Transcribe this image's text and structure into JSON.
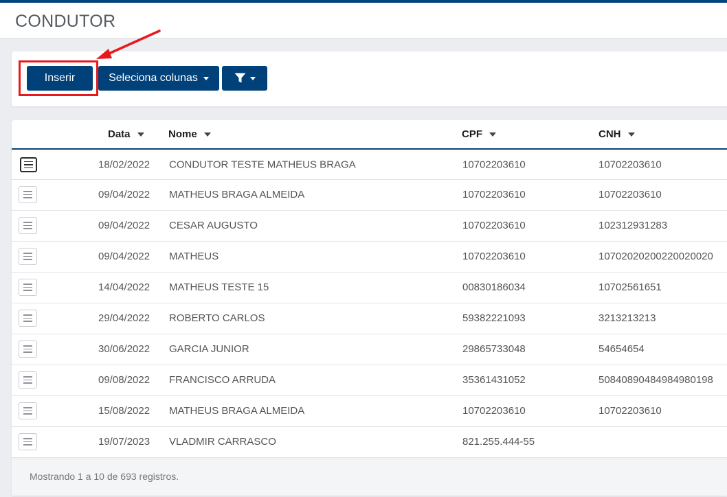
{
  "page": {
    "title": "CONDUTOR"
  },
  "toolbar": {
    "insert_label": "Inserir",
    "columns_label": "Seleciona colunas",
    "filter_icon": "filter-icon"
  },
  "colors": {
    "primary": "#00417a",
    "highlight": "#e8191d"
  },
  "table": {
    "columns": [
      "Data",
      "Nome",
      "CPF",
      "CNH"
    ],
    "rows": [
      {
        "data": "18/02/2022",
        "nome": "CONDUTOR TESTE MATHEUS BRAGA",
        "cpf": "10702203610",
        "cnh": "10702203610"
      },
      {
        "data": "09/04/2022",
        "nome": "MATHEUS BRAGA ALMEIDA",
        "cpf": "10702203610",
        "cnh": "10702203610"
      },
      {
        "data": "09/04/2022",
        "nome": "CESAR AUGUSTO",
        "cpf": "10702203610",
        "cnh": "102312931283"
      },
      {
        "data": "09/04/2022",
        "nome": "MATHEUS",
        "cpf": "10702203610",
        "cnh": "10702020200220020020"
      },
      {
        "data": "14/04/2022",
        "nome": "MATHEUS TESTE 15",
        "cpf": "00830186034",
        "cnh": "10702561651"
      },
      {
        "data": "29/04/2022",
        "nome": "ROBERTO CARLOS",
        "cpf": "59382221093",
        "cnh": "3213213213"
      },
      {
        "data": "30/06/2022",
        "nome": "GARCIA JUNIOR",
        "cpf": "29865733048",
        "cnh": "54654654"
      },
      {
        "data": "09/08/2022",
        "nome": "FRANCISCO ARRUDA",
        "cpf": "35361431052",
        "cnh": "50840890484984980198"
      },
      {
        "data": "15/08/2022",
        "nome": "MATHEUS BRAGA ALMEIDA",
        "cpf": "10702203610",
        "cnh": "10702203610"
      },
      {
        "data": "19/07/2023",
        "nome": "VLADMIR CARRASCO",
        "cpf": "821.255.444-55",
        "cnh": ""
      }
    ],
    "footer": "Mostrando 1 a 10 de 693 registros."
  }
}
